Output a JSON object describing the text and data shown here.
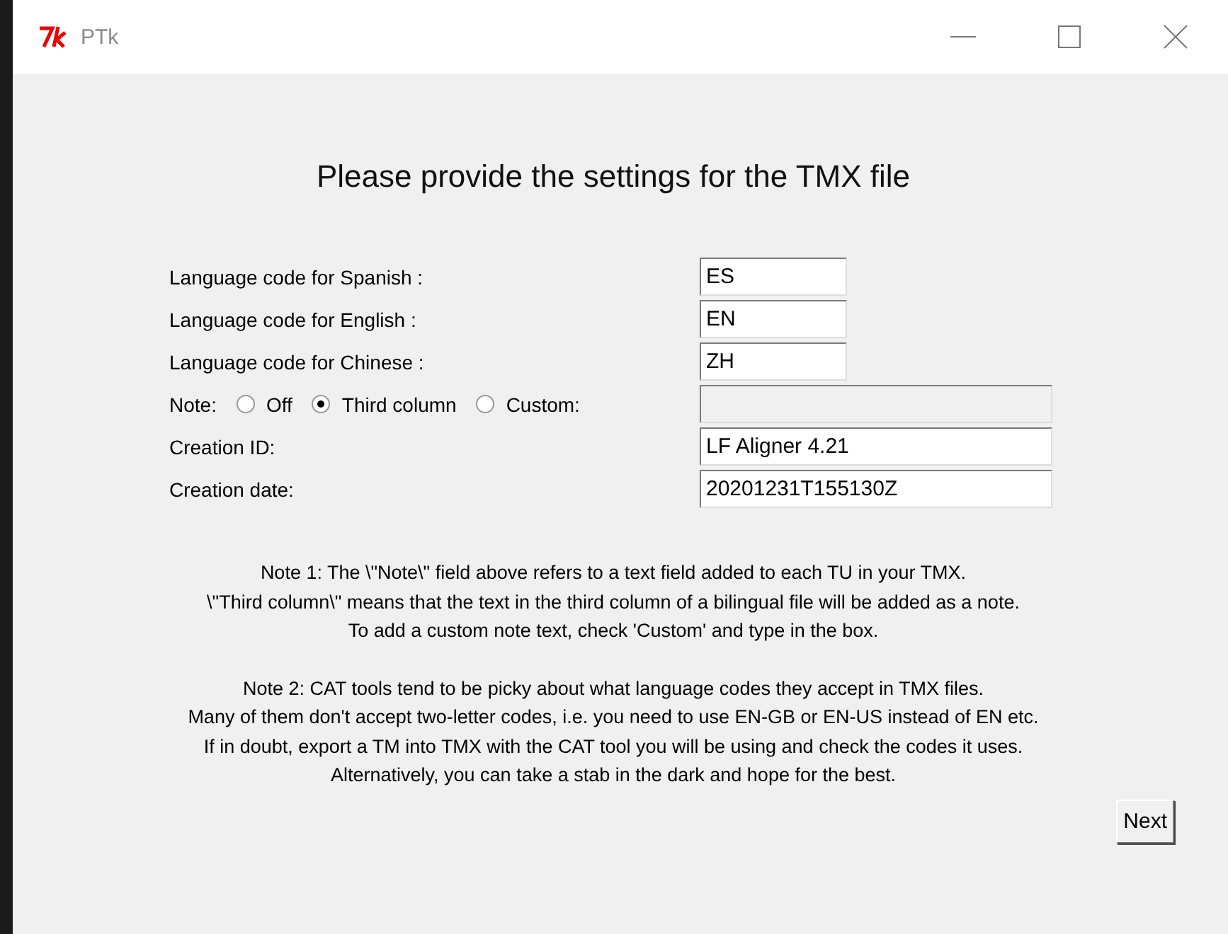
{
  "window": {
    "title": "PTk"
  },
  "heading": "Please provide the settings for the TMX file",
  "fields": [
    {
      "kind": "text",
      "label": "Language code for Spanish :",
      "value": "ES",
      "wide": false
    },
    {
      "kind": "text",
      "label": "Language code for English :",
      "value": "EN",
      "wide": false
    },
    {
      "kind": "text",
      "label": "Language code for Chinese :",
      "value": "ZH",
      "wide": false
    },
    {
      "kind": "radio",
      "label": "Note:",
      "options": [
        {
          "label": "Off",
          "selected": false
        },
        {
          "label": "Third column",
          "selected": true
        },
        {
          "label": "Custom:",
          "selected": false
        }
      ],
      "disabled": true
    },
    {
      "kind": "text",
      "label": "Creation ID:",
      "value": "LF Aligner 4.21",
      "wide": true
    },
    {
      "kind": "text",
      "label": "Creation date:",
      "value": "20201231T155130Z",
      "wide": true
    }
  ],
  "notes": [
    [
      "Note 1: The \\\"Note\\\" field above refers to a text field added to each TU in your TMX.",
      "\\\"Third column\\\" means that the text in the third column of a bilingual file will be added as a note.",
      "To add a custom note text, check 'Custom' and type in the box."
    ],
    [
      "Note 2: CAT tools tend to be picky about what language codes they accept in TMX files.",
      "Many of them don't accept two-letter codes, i.e. you need to use EN-GB or EN-US instead of EN etc.",
      "If in doubt, export a TM into TMX with the CAT tool you will be using and check the codes it uses.",
      "Alternatively, you can take a stab in the dark and hope for the best."
    ]
  ],
  "button": "Next"
}
